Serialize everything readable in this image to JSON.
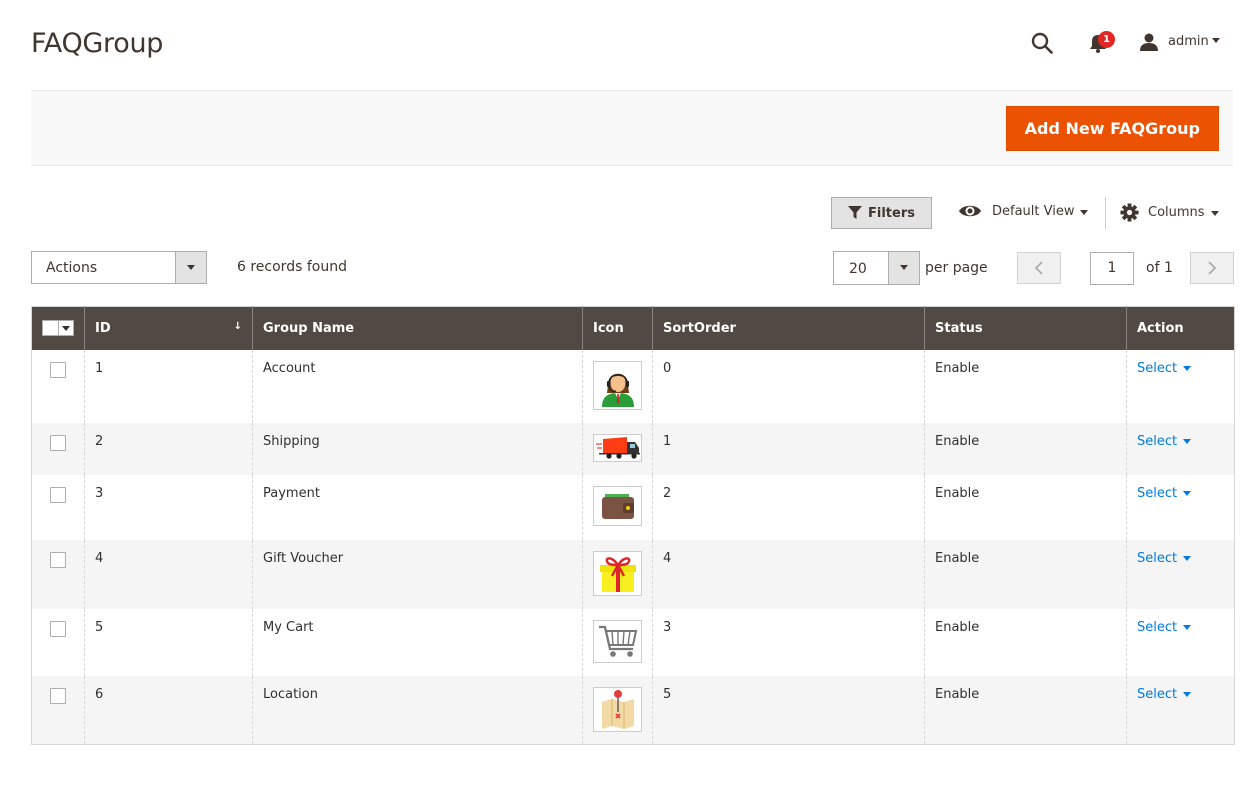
{
  "header": {
    "title": "FAQGroup",
    "notifications_count": "1",
    "user_name": "admin"
  },
  "page_actions": {
    "add_button_label": "Add New FAQGroup"
  },
  "toolbar": {
    "filters_label": "Filters",
    "view_label": "Default View",
    "columns_label": "Columns",
    "actions_label": "Actions",
    "records_found": "6 records found",
    "per_page_value": "20",
    "per_page_label": "per page",
    "current_page": "1",
    "total_pages_label": "of 1"
  },
  "grid": {
    "columns": {
      "id": "ID",
      "group_name": "Group Name",
      "icon": "Icon",
      "sort_order": "SortOrder",
      "status": "Status",
      "action": "Action"
    },
    "rows": [
      {
        "id": "1",
        "group_name": "Account",
        "icon": "customer-service-agent-icon",
        "sort_order": "0",
        "status": "Enable",
        "action": "Select"
      },
      {
        "id": "2",
        "group_name": "Shipping",
        "icon": "delivery-truck-icon",
        "sort_order": "1",
        "status": "Enable",
        "action": "Select"
      },
      {
        "id": "3",
        "group_name": "Payment",
        "icon": "wallet-icon",
        "sort_order": "2",
        "status": "Enable",
        "action": "Select"
      },
      {
        "id": "4",
        "group_name": "Gift Voucher",
        "icon": "gift-box-icon",
        "sort_order": "4",
        "status": "Enable",
        "action": "Select"
      },
      {
        "id": "5",
        "group_name": "My Cart",
        "icon": "shopping-cart-icon",
        "sort_order": "3",
        "status": "Enable",
        "action": "Select"
      },
      {
        "id": "6",
        "group_name": "Location",
        "icon": "map-pin-icon",
        "sort_order": "5",
        "status": "Enable",
        "action": "Select"
      }
    ]
  },
  "colors": {
    "accent": "#eb5202",
    "header_bg": "#514943",
    "link": "#007bdb",
    "badge": "#e22626"
  }
}
